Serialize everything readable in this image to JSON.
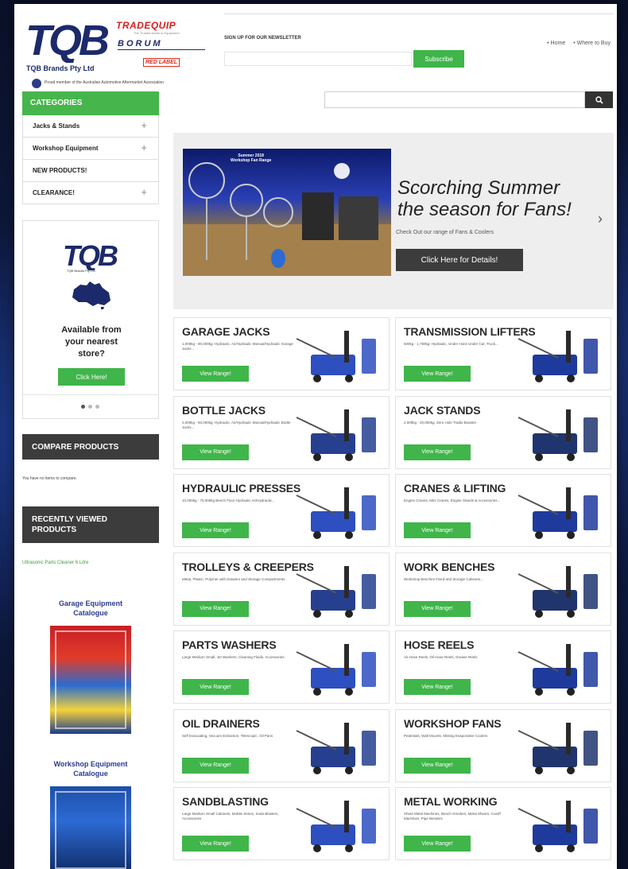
{
  "header": {
    "logo_text": "TQB",
    "brand_name": "TQB Brands Pty Ltd",
    "tradequip": "TRADEQUIP",
    "tradequip_sub": "The Trusted Name in Equipment",
    "borum": "BORUM",
    "redlabel": "RED LABEL",
    "member_text": "Proud member of the Australian Automotive Aftermarket Association",
    "newsletter_label": "SIGN UP FOR OUR NEWSLETTER",
    "subscribe_label": "Subscribe",
    "links": [
      "• Home",
      "• Where to Buy"
    ]
  },
  "search": {
    "placeholder": ""
  },
  "sidebar": {
    "categories_title": "CATEGORIES",
    "items": [
      {
        "label": "Jacks & Stands",
        "expandable": true
      },
      {
        "label": "Workshop Equipment",
        "expandable": true
      },
      {
        "label": "NEW PRODUCTS!",
        "expandable": false
      },
      {
        "label": "CLEARANCE!",
        "expandable": true
      }
    ],
    "promo": {
      "logo": "TQB",
      "logo_sub": "TQB Brands Pty Ltd",
      "text_line1": "Available from",
      "text_line2": "your nearest",
      "text_line3": "store?",
      "button": "Click Here!"
    },
    "compare_title": "COMPARE PRODUCTS",
    "compare_text": "You have no items to compare.",
    "recent_title_line1": "RECENTLY VIEWED",
    "recent_title_line2": "PRODUCTS",
    "recent_link": "Ultrasonic Parts Cleaner 6 Litre",
    "catalogue1_line1": "Garage Equipment",
    "catalogue1_line2": "Catalogue",
    "catalogue2_line1": "Workshop Equipment",
    "catalogue2_line2": "Catalogue"
  },
  "hero": {
    "image_label_line1": "Summer 2018",
    "image_label_line2": "Workshop Fan Range",
    "heading_line1": "Scorching Summer",
    "heading_line2": "the season for Fans!",
    "sub": "Check Out our range of Fans & Coolers",
    "button": "Click Here for Details!"
  },
  "tiles": [
    {
      "title": "GARAGE JACKS",
      "desc": "1,000kg - 80,000kg: Hydraulic, Air/Hydraulic Manual/Hydraulic Garage Jacks...",
      "button": "View Range!"
    },
    {
      "title": "TRANSMISSION LIFTERS",
      "desc": "500kg - 1,750kg: Hydraulic, Under Hoist Under Car, Truck...",
      "button": "View Range!"
    },
    {
      "title": "BOTTLE JACKS",
      "desc": "2,000kg - 50,000kg: Hydraulic, Air/Hydraulic Manual/Hydraulic Bottle Jacks...",
      "button": "View Range!"
    },
    {
      "title": "JACK STANDS",
      "desc": "2,000kg - 20,000kg: Zero Hole Tradie Boaster",
      "button": "View Range!"
    },
    {
      "title": "HYDRAULIC PRESSES",
      "desc": "10,000kg - 75,000kg Bench Floor Hydraulic Air/Hydraulic...",
      "button": "View Range!"
    },
    {
      "title": "CRANES & LIFTING",
      "desc": "Engine Cranes, Mini Cranes, Engine Stands & Accessories...",
      "button": "View Range!"
    },
    {
      "title": "TROLLEYS & CREEPERS",
      "desc": "Metal, Plastic, Polymer with Drawers and Storage Compartments",
      "button": "View Range!"
    },
    {
      "title": "WORK BENCHES",
      "desc": "Workshop Benches Fixed and Storage Cabinets...",
      "button": "View Range!"
    },
    {
      "title": "PARTS WASHERS",
      "desc": "Large Medium Small, Jet Washers, Cleaning Fluids, Accessories",
      "button": "View Range!"
    },
    {
      "title": "HOSE REELS",
      "desc": "Air Hose Reels, Oil Hose Reels, Grease Reels",
      "button": "View Range!"
    },
    {
      "title": "OIL DRAINERS",
      "desc": "Self Evacuating, Vacuum Extraction, Telescopic, Oil Pans",
      "button": "View Range!"
    },
    {
      "title": "WORKSHOP FANS",
      "desc": "Pedestals, Wall Mounts, Misting Evaporative Coolers",
      "button": "View Range!"
    },
    {
      "title": "SANDBLASTING",
      "desc": "Large Medium Small Cabinets, Mobile Series, Soda Blasters, Accessories",
      "button": "View Range!"
    },
    {
      "title": "METAL WORKING",
      "desc": "Sheet Metal Machines, Bench Grinders, Metal Shears, Cutoff Machines, Pipe Benders",
      "button": "View Range!"
    }
  ],
  "colors": {
    "accent_green": "#3fb54a",
    "dark_header": "#3c3c3c",
    "brand_blue": "#1c2a6b",
    "brand_red": "#d62020"
  }
}
